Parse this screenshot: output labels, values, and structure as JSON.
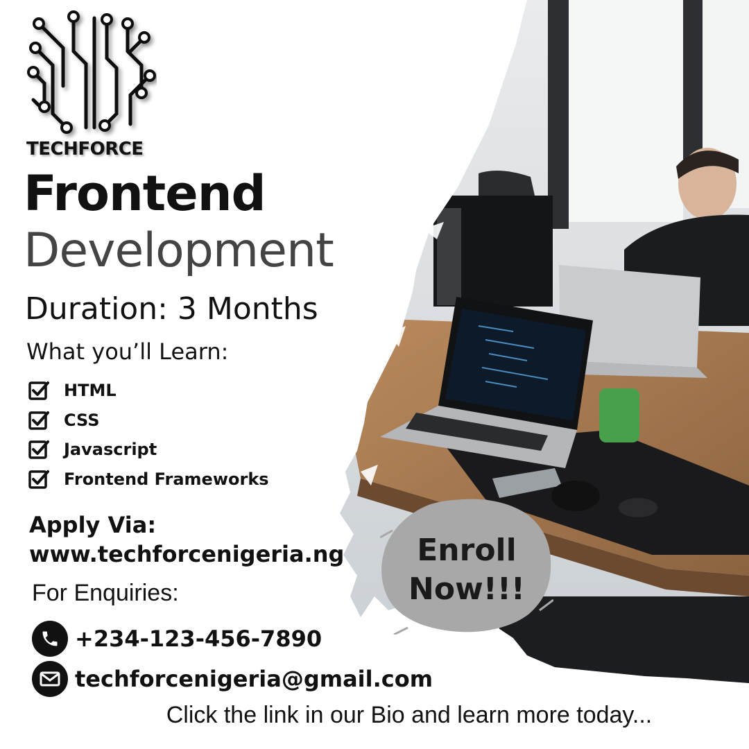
{
  "brand": {
    "name": "TECHFORCE"
  },
  "headline": {
    "line1": "Frontend",
    "line2": "Development"
  },
  "duration": "Duration: 3 Months",
  "learn": {
    "heading": "What you’ll Learn:",
    "items": [
      "HTML",
      "CSS",
      "Javascript",
      "Frontend Frameworks"
    ]
  },
  "apply": {
    "label": "Apply Via:",
    "url": "www.techforcenigeria.ng"
  },
  "enquiries": {
    "label": "For Enquiries:",
    "phone": "+234-123-456-7890",
    "email": "techforcenigeria@gmail.com"
  },
  "cta": {
    "line1": "Enroll",
    "line2": "Now!!!"
  },
  "footer": "Click the link in our Bio and learn more today...",
  "colors": {
    "text": "#111111",
    "subtitle": "#444444",
    "badge": "#a8a8a8",
    "icon_circle": "#111111"
  },
  "icons": [
    "circuit-brain-logo",
    "checkbox-icon",
    "phone-icon",
    "mail-icon"
  ]
}
